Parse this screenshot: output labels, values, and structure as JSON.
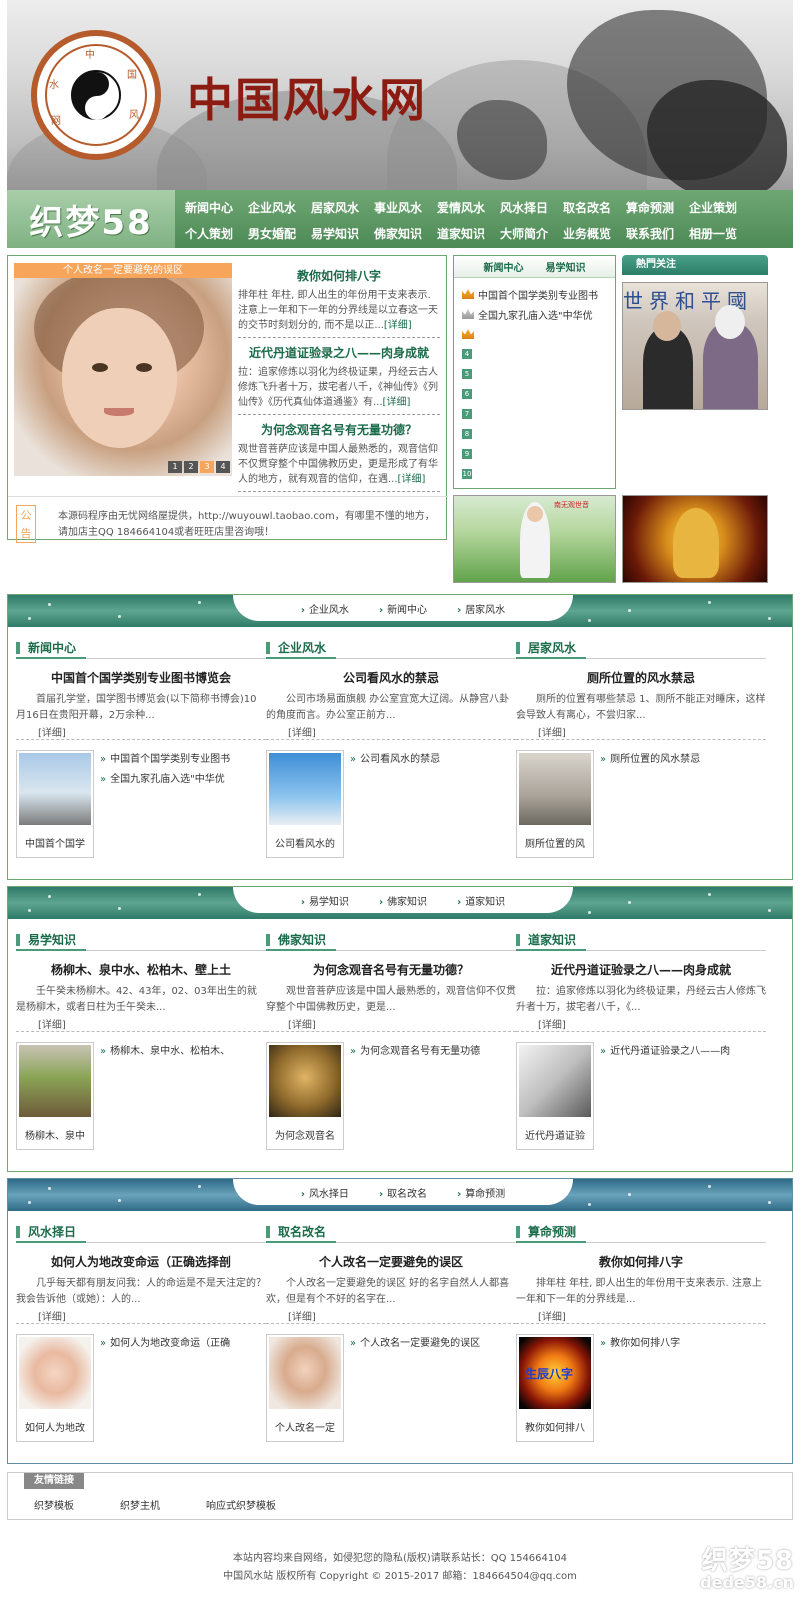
{
  "header": {
    "site_title": "中国风水网",
    "seal_chars": [
      "中",
      "国",
      "风",
      "水",
      "网"
    ]
  },
  "nav": {
    "logo": "织梦58",
    "row1": [
      "新闻中心",
      "企业风水",
      "居家风水",
      "事业风水",
      "爱情风水",
      "风水择日",
      "取名改名",
      "算命预测",
      "企业策划"
    ],
    "row2": [
      "个人策划",
      "男女婚配",
      "易学知识",
      "佛家知识",
      "道家知识",
      "大师简介",
      "业务概览",
      "联系我们",
      "相册一览"
    ]
  },
  "focus": {
    "caption": "个人改名一定要避免的误区",
    "dots": [
      "1",
      "2",
      "3",
      "4"
    ],
    "news": [
      {
        "title": "教你如何排八字",
        "text": "排年柱 年柱, 即人出生的年份用干支来表示. 注意上一年和下一年的分界线是以立春这一天的交节时刻划分的, 而不是以正...",
        "more": "[详细]"
      },
      {
        "title": "近代丹道证验录之八——肉身成就",
        "text": "拉：追家修炼以羽化为终极证果，丹经云古人修炼飞升者十万，拔宅者八千，《神仙传》《列仙传》《历代真仙体道通鉴》有...",
        "more": "[详细]"
      },
      {
        "title": "为何念观音名号有无量功德？",
        "text": "观世音菩萨应该是中国人最熟悉的，观音信仰不仅贯穿整个中国佛教历史，更是形成了有华人的地方，就有观音的信仰，在遇...",
        "more": "[详细]"
      }
    ]
  },
  "notice": {
    "tag": "公告",
    "text": "本源码程序由无忧网络屋提供，http://wuyouwl.taobao.com，有哪里不懂的地方，请加店主QQ 184664104或者旺旺店里咨询哦！"
  },
  "midbox": {
    "tabs": [
      "新闻中心",
      "易学知识"
    ],
    "items": [
      {
        "icon": "crown",
        "text": "中国首个国学类别专业图书"
      },
      {
        "icon": "crown-gray",
        "text": "全国九家孔庙入选\"中华优"
      },
      {
        "icon": "crown",
        "text": ""
      },
      {
        "icon": "num",
        "text": "",
        "num": "4"
      },
      {
        "icon": "num",
        "text": "",
        "num": "5"
      },
      {
        "icon": "num",
        "text": "",
        "num": "6"
      },
      {
        "icon": "num",
        "text": "",
        "num": "7"
      },
      {
        "icon": "num",
        "text": "",
        "num": "8"
      },
      {
        "icon": "num",
        "text": "",
        "num": "9"
      },
      {
        "icon": "num",
        "text": "",
        "num": "10"
      }
    ]
  },
  "hot": {
    "title": "熱門关注",
    "banner_text": "世界和平國"
  },
  "sub1_label": "南无观世音",
  "sections": [
    {
      "tabs": [
        "企业风水",
        "新闻中心",
        "居家风水"
      ],
      "cols": [
        {
          "head": "新闻中心",
          "title": "中国首个国学类别专业图书博览会",
          "text": "首届孔学堂，国学图书博览会(以下简称书博会)10月16日在贵阳开幕，2万余种...",
          "more": "[详细]",
          "thumb_cap": "中国首个国学",
          "links": [
            "中国首个国学类别专业图书",
            "全国九家孔庙入选\"中华优"
          ],
          "img": "statue"
        },
        {
          "head": "企业风水",
          "title": "公司看风水的禁忌",
          "text": "公司市场易面旗舰 办公室宜宽大辽阔。从静宫八卦的角度而言。办公室正前方...",
          "more": "[详细]",
          "thumb_cap": "公司看风水的",
          "links": [
            "公司看风水的禁忌"
          ],
          "img": "tower"
        },
        {
          "head": "居家风水",
          "title": "厕所位置的风水禁忌",
          "text": "厕所的位置有哪些禁忌 1、厕所不能正对睡床，这样会导致人有离心，不尝归家...",
          "more": "[详细]",
          "thumb_cap": "厕所位置的风",
          "links": [
            "厕所位置的风水禁忌"
          ],
          "img": "bath"
        }
      ]
    },
    {
      "tabs": [
        "易学知识",
        "佛家知识",
        "道家知识"
      ],
      "cols": [
        {
          "head": "易学知识",
          "title": "杨柳木、泉中水、松柏木、壁上土",
          "text": "壬午癸未杨柳木。42、43年，02、03年出生的就是杨柳木，或者日柱为壬午癸未...",
          "more": "[详细]",
          "thumb_cap": "杨柳木、泉中",
          "links": [
            "杨柳木、泉中水、松柏木、"
          ],
          "img": "trees"
        },
        {
          "head": "佛家知识",
          "title": "为何念观音名号有无量功德？",
          "text": "观世音菩萨应该是中国人最熟悉的，观音信仰不仅贯穿整个中国佛教历史，更是...",
          "more": "[详细]",
          "thumb_cap": "为何念观音名",
          "links": [
            "为何念观音名号有无量功德"
          ],
          "img": "buddha"
        },
        {
          "head": "道家知识",
          "title": "近代丹道证验录之八——肉身成就",
          "text": "拉：追家修炼以羽化为终极证果，丹经云古人修炼飞升者十万，拔宅者八千，《...",
          "more": "[详细]",
          "thumb_cap": "近代丹道证验",
          "links": [
            "近代丹道证验录之八——肉"
          ],
          "img": "taiji"
        }
      ]
    },
    {
      "tabs": [
        "风水择日",
        "取名改名",
        "算命预测"
      ],
      "cols": [
        {
          "head": "风水择日",
          "title": "如何人为地改变命运（正确选择剖",
          "text": "几乎每天都有朋友问我：人的命运是不是天注定的？我会告诉他（或她）：人的...",
          "more": "[详细]",
          "thumb_cap": "如何人为地改",
          "links": [
            "如何人为地改变命运（正确"
          ],
          "img": "mother"
        },
        {
          "head": "取名改名",
          "title": "个人改名一定要避免的误区",
          "text": "个人改名一定要避免的误区 好的名字自然人人都喜欢，但是有个不好的名字在...",
          "more": "[详细]",
          "thumb_cap": "个人改名一定",
          "links": [
            "个人改名一定要避免的误区"
          ],
          "img": "girl"
        },
        {
          "head": "算命预测",
          "title": "教你如何排八字",
          "text": "排年柱 年柱, 即人出生的年份用干支来表示. 注意上一年和下一年的分界线是...",
          "more": "[详细]",
          "thumb_cap": "教你如何排八",
          "links": [
            "教你如何排八字"
          ],
          "img": "fire"
        }
      ]
    }
  ],
  "fire_text": "生辰八字",
  "friend": {
    "title": "友情链接",
    "links": [
      "织梦模板",
      "织梦主机",
      "响应式织梦模板"
    ]
  },
  "footer": {
    "line1": "本站内容均来自网络，如侵犯您的隐私(版权)请联系站长：QQ 154664104",
    "line2": "中国风水站 版权所有 Copyright © 2015-2017 邮箱：184664504@qq.com"
  },
  "watermark": {
    "line1": "织梦58",
    "line2": "dede58.cn"
  }
}
